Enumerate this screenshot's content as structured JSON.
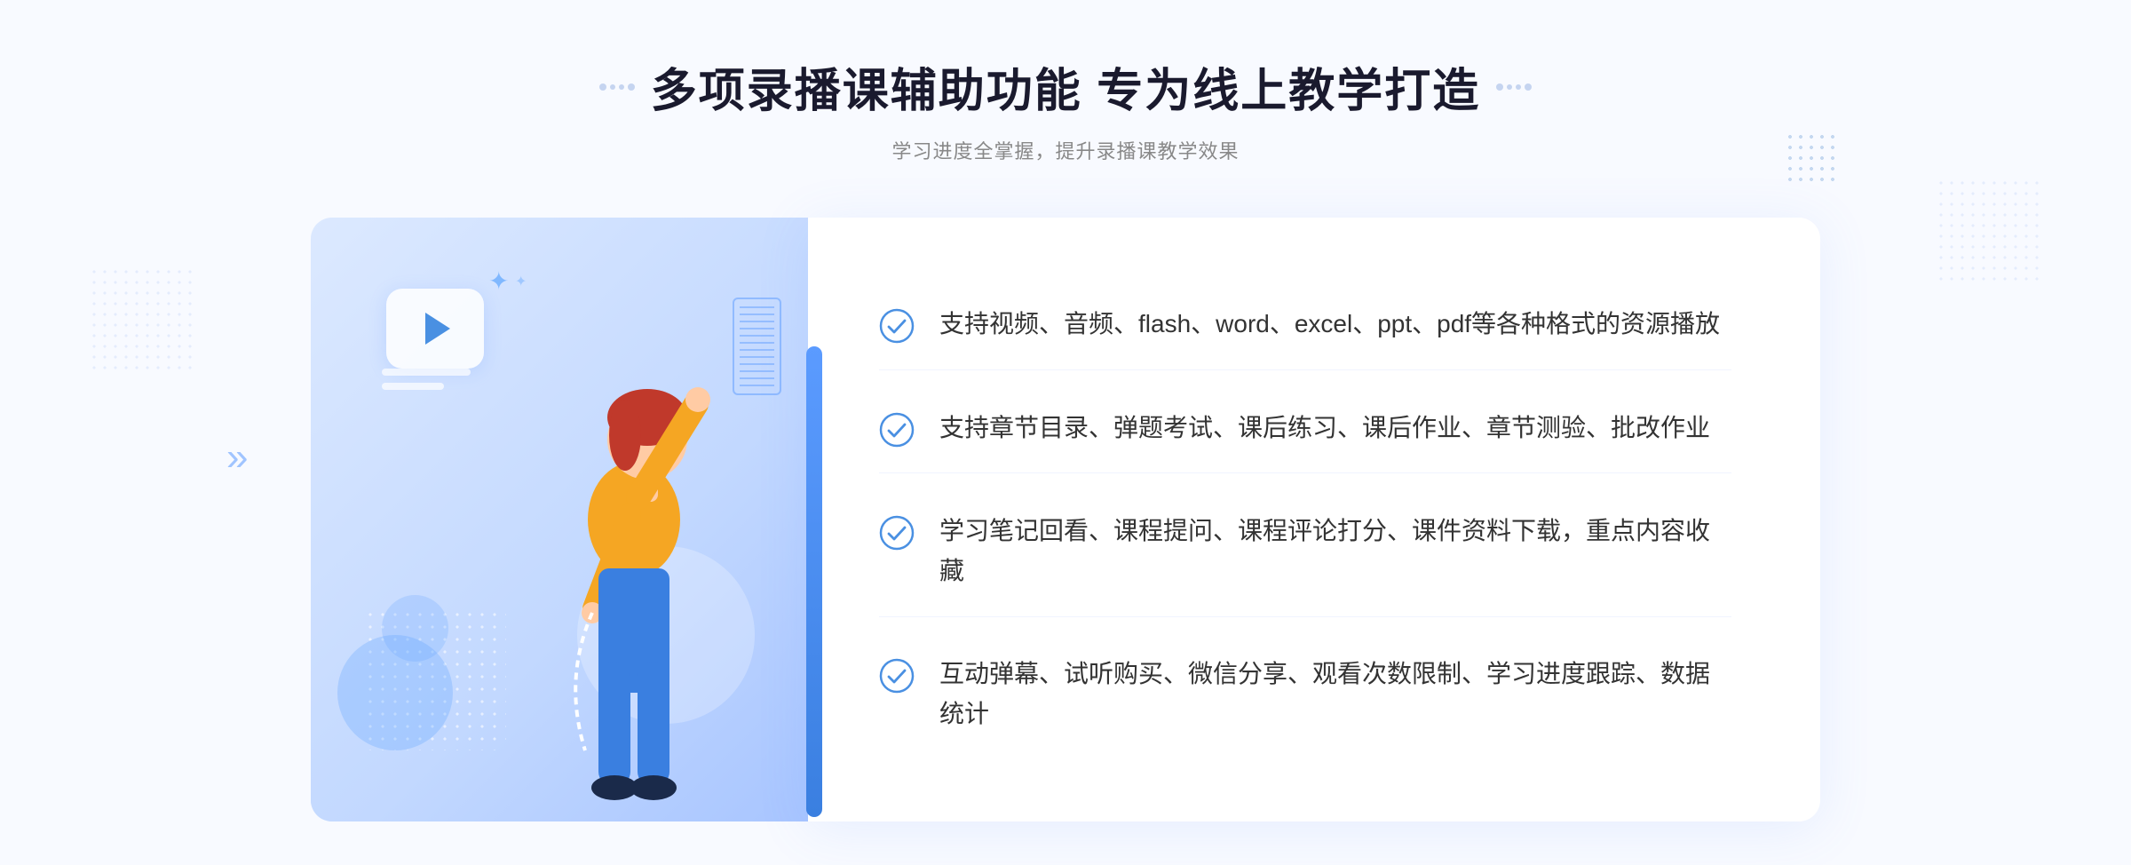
{
  "header": {
    "title": "多项录播课辅助功能 专为线上教学打造",
    "subtitle": "学习进度全掌握，提升录播课教学效果",
    "deco_dots": [
      "·",
      "·",
      "·",
      "·"
    ]
  },
  "features": [
    {
      "id": "feature-1",
      "text": "支持视频、音频、flash、word、excel、ppt、pdf等各种格式的资源播放"
    },
    {
      "id": "feature-2",
      "text": "支持章节目录、弹题考试、课后练习、课后作业、章节测验、批改作业"
    },
    {
      "id": "feature-3",
      "text": "学习笔记回看、课程提问、课程评论打分、课件资料下载，重点内容收藏"
    },
    {
      "id": "feature-4",
      "text": "互动弹幕、试听购买、微信分享、观看次数限制、学习进度跟踪、数据统计"
    }
  ],
  "colors": {
    "blue_primary": "#4a90e2",
    "blue_light": "#c2d8ff",
    "blue_dark": "#3a7fe0",
    "text_dark": "#1a1a2e",
    "text_gray": "#888888",
    "text_body": "#333333",
    "white": "#ffffff",
    "bg": "#f8faff"
  },
  "check_icon_color": "#4a90e2",
  "decoration": {
    "chevron": "»",
    "outer_dots": "⁝⁝",
    "play_button": "▶"
  }
}
